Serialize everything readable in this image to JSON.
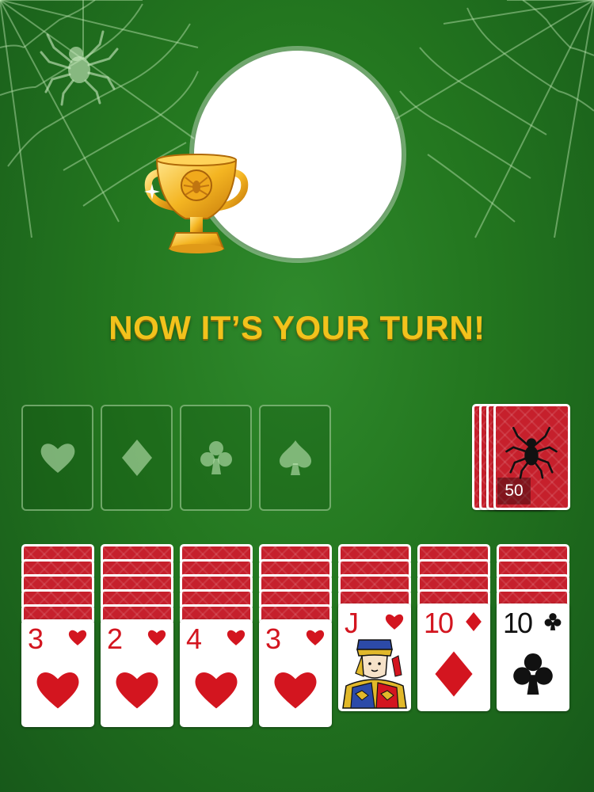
{
  "headline": "NOW IT’S YOUR TURN!",
  "icons": {
    "spider": "spider-icon",
    "trophy": "trophy-icon",
    "web": "spiderweb-decoration"
  },
  "colors": {
    "table_green": "#23761f",
    "headline_gold": "#f2c21c",
    "card_back_red": "#c6202c",
    "suit_red": "#d3151f",
    "suit_black": "#111111"
  },
  "foundations": [
    {
      "suit": "heart"
    },
    {
      "suit": "diamond"
    },
    {
      "suit": "club"
    },
    {
      "suit": "spade"
    }
  ],
  "stock": {
    "count": "50"
  },
  "tableau": [
    {
      "hidden": 5,
      "rank": "3",
      "suit": "heart"
    },
    {
      "hidden": 5,
      "rank": "2",
      "suit": "heart"
    },
    {
      "hidden": 5,
      "rank": "4",
      "suit": "heart"
    },
    {
      "hidden": 5,
      "rank": "3",
      "suit": "heart"
    },
    {
      "hidden": 4,
      "rank": "J",
      "suit": "heart"
    },
    {
      "hidden": 4,
      "rank": "10",
      "suit": "diamond"
    },
    {
      "hidden": 4,
      "rank": "10",
      "suit": "club"
    }
  ]
}
